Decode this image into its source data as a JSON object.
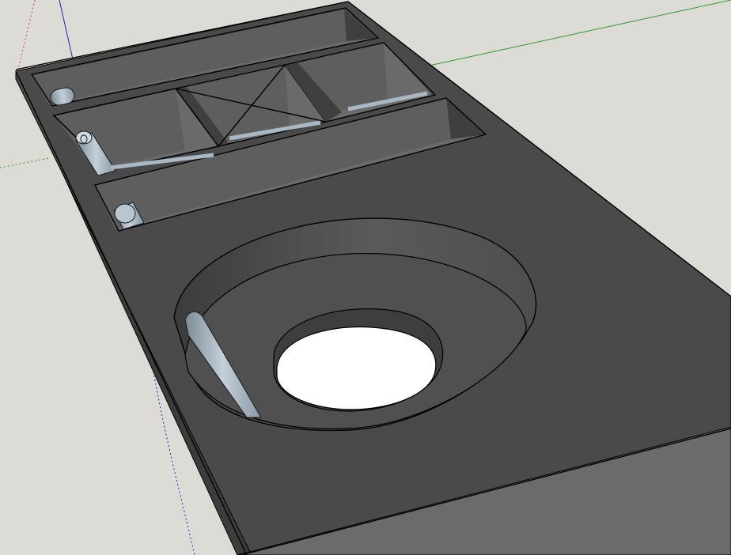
{
  "viewport": {
    "background": "#dcdbd6",
    "axis_colors": {
      "red": "#c24a4a",
      "green": "#2f9a2f",
      "blue": "#2424c8"
    }
  },
  "model": {
    "body_top_color": "#4a4a4a",
    "body_front_color": "#6b6b6b",
    "body_side_color": "#3c3c3c",
    "pocket_floor_color": "#6a6a6a",
    "pocket_wall_color": "#5e5e5e",
    "rod_color": "#a9b8c4",
    "edge_color": "#000000"
  }
}
